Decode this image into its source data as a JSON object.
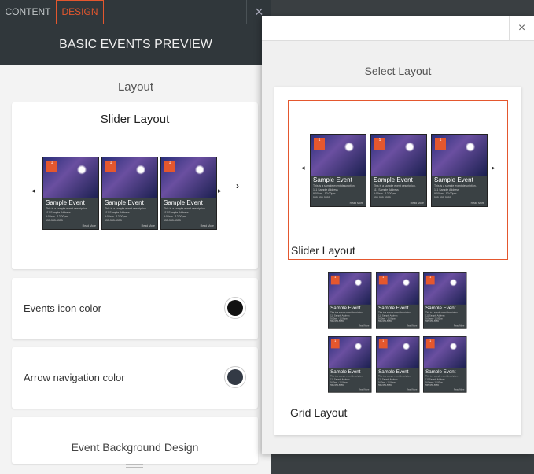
{
  "tabs": {
    "content": "CONTENT",
    "design": "DESIGN"
  },
  "panel_title": "BASIC EVENTS PREVIEW",
  "layout_heading": "Layout",
  "slider_card_title": "Slider Layout",
  "events_icon_color": {
    "label": "Events icon color",
    "color": "#111111"
  },
  "arrow_nav_color": {
    "label": "Arrow navigation color",
    "color": "#333a45"
  },
  "event_bg_heading": "Event Background Design",
  "popup": {
    "title": "Select Layout",
    "options": [
      {
        "label": "Slider Layout",
        "selected": true
      },
      {
        "label": "Grid Layout",
        "selected": false
      }
    ]
  },
  "event_sample": {
    "badge": "1",
    "title": "Sample Event",
    "desc": "This is a sample event description.",
    "address": "111 Sample Address",
    "time": "9:00am - 12:00pm",
    "phone": "555-555-5555",
    "more": "Read More"
  },
  "colors": {
    "accent": "#e4572e",
    "header": "#30373b"
  }
}
